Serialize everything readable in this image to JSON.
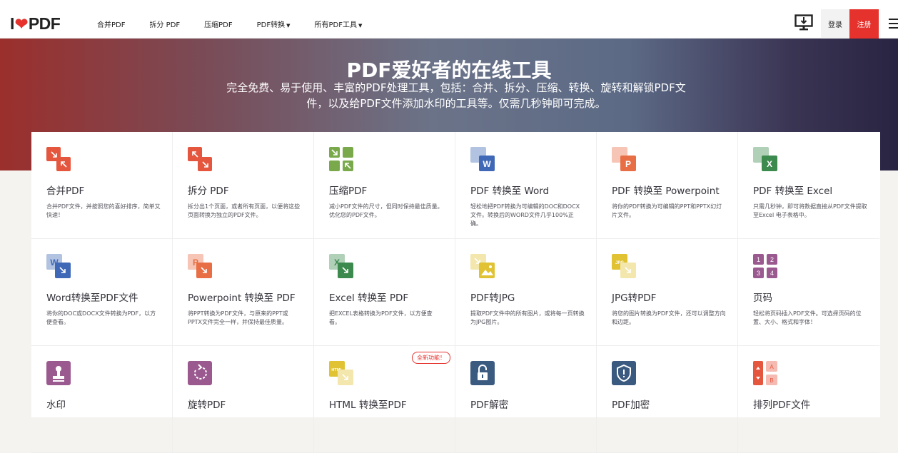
{
  "header": {
    "logo_text_left": "I",
    "logo_text_right": "PDF",
    "nav": [
      {
        "label": "合并PDF",
        "dropdown": false
      },
      {
        "label": "拆分 PDF",
        "dropdown": false
      },
      {
        "label": "压缩PDF",
        "dropdown": false
      },
      {
        "label": "PDF转换",
        "dropdown": true
      },
      {
        "label": "所有PDF工具",
        "dropdown": true
      }
    ],
    "login": "登录",
    "signup": "注册",
    "accent": "#e5322d"
  },
  "hero": {
    "title": "PDF爱好者的在线工具",
    "subtitle": "完全免费、易于使用、丰富的PDF处理工具，包括：合并、拆分、压缩、转换、旋转和解锁PDF文件，以及给PDF文件添加水印的工具等。仅需几秒钟即可完成。"
  },
  "tools": [
    {
      "title": "合并PDF",
      "desc": "合并PDF文件，并按照您的喜好排序，简单又快速！",
      "icon": "merge-icon",
      "color": "#e5563f"
    },
    {
      "title": "拆分 PDF",
      "desc": "拆分出1个页面，或者所有页面，以便将这些页面转换为独立的PDF文件。",
      "icon": "split-icon",
      "color": "#e5563f"
    },
    {
      "title": "压缩PDF",
      "desc": "减小PDF文件的尺寸，但同时保持最佳质量。优化您的PDF文件。",
      "icon": "compress-icon",
      "color": "#79a94b"
    },
    {
      "title": "PDF 转换至 Word",
      "desc": "轻松地把PDF转换为可编辑的DOC和DOCX文件。转换后的WORD文件几乎100%正确。",
      "icon": "word-icon",
      "color": "#3f68b6"
    },
    {
      "title": "PDF 转换至 Powerpoint",
      "desc": "将你的PDF转换为可编辑的PPT和PPTX幻灯片文件。",
      "icon": "powerpoint-icon",
      "color": "#e86e45"
    },
    {
      "title": "PDF 转换至 Excel",
      "desc": "只需几秒钟，即可将数据直接从PDF文件提取至Excel 电子表格中。",
      "icon": "excel-icon",
      "color": "#3c8a4d"
    },
    {
      "title": "Word转换至PDF文件",
      "desc": "将你的DOC或DOCX文件转换为PDF，以方便查看。",
      "icon": "word-to-pdf-icon",
      "color": "#3f68b6"
    },
    {
      "title": "Powerpoint 转换至 PDF",
      "desc": "将PPT转换为PDF文件，与原来的PPT或PPTX文件完全一样，并保持最佳质量。",
      "icon": "ppt-to-pdf-icon",
      "color": "#e86e45"
    },
    {
      "title": "Excel 转换至 PDF",
      "desc": "把EXCEL表格转换为PDF文件，以方便查看。",
      "icon": "excel-to-pdf-icon",
      "color": "#3c8a4d"
    },
    {
      "title": "PDF转JPG",
      "desc": "提取PDF文件中的所有图片，或将每一页转换为JPG图片。",
      "icon": "pdf-to-jpg-icon",
      "color": "#e0c232"
    },
    {
      "title": "JPG转PDF",
      "desc": "将您的图片转换为PDF文件，还可以调整方向和边距。",
      "icon": "jpg-to-pdf-icon",
      "color": "#e0c232"
    },
    {
      "title": "页码",
      "desc": "轻松将页码插入PDF文件。可选择页码的位置、大小、格式和字体！",
      "icon": "page-numbers-icon",
      "color": "#9a5a8f"
    },
    {
      "title": "水印",
      "desc": "",
      "icon": "watermark-icon",
      "color": "#9a5a8f"
    },
    {
      "title": "旋转PDF",
      "desc": "",
      "icon": "rotate-icon",
      "color": "#9a5a8f"
    },
    {
      "title": "HTML 转换至PDF",
      "desc": "",
      "icon": "html-to-pdf-icon",
      "color": "#e0c232",
      "badge": "全新功能！"
    },
    {
      "title": "PDF解密",
      "desc": "",
      "icon": "unlock-icon",
      "color": "#3b5a80"
    },
    {
      "title": "PDF加密",
      "desc": "",
      "icon": "protect-icon",
      "color": "#3b5a80"
    },
    {
      "title": "排列PDF文件",
      "desc": "",
      "icon": "organize-icon",
      "color": "#e5563f"
    }
  ]
}
